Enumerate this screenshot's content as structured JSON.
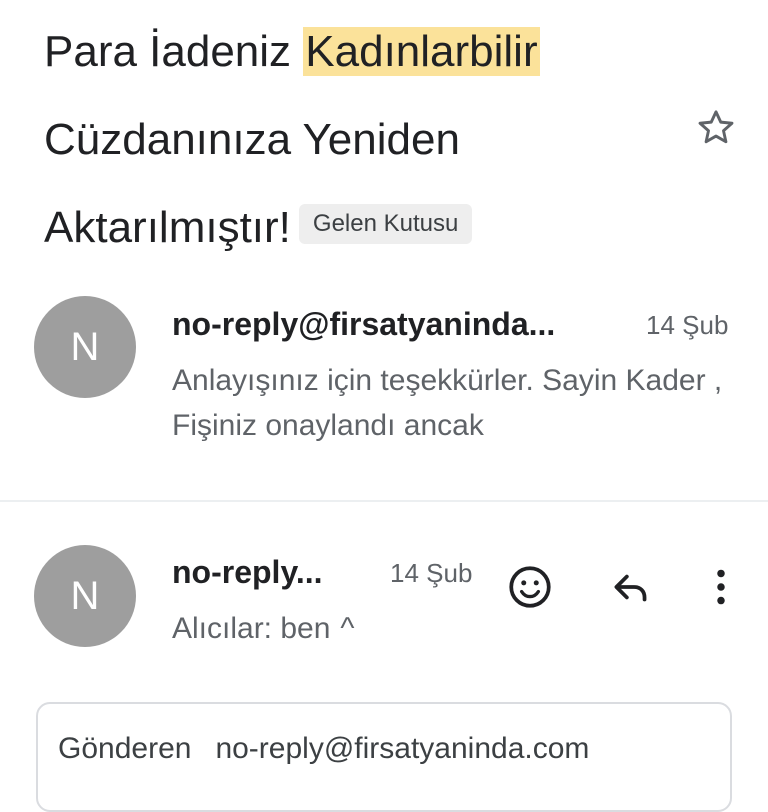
{
  "email": {
    "subject_prefix": "Para İadeniz ",
    "subject_highlight": "Kadınlarbilir",
    "subject_suffix": " Cüzdanınıza Yeniden Aktarılmıştır!",
    "label": "Gelen Kutusu",
    "star_icon": "star-outline-icon"
  },
  "messages": [
    {
      "avatar_letter": "N",
      "sender": "no-reply@firsatyaninda...",
      "date": "14 Şub",
      "snippet": "Anlayışınız için teşekkürler. Sayin Kader , Fişiniz onaylandı ancak"
    },
    {
      "avatar_letter": "N",
      "sender": "no-reply...",
      "date": "14 Şub",
      "recipients": "Alıcılar: ben",
      "recipients_chevron": "^",
      "actions": [
        "emoji-reaction-icon",
        "reply-icon",
        "more-vert-icon"
      ],
      "details": {
        "from_label": "Gönderen",
        "from_value": "no-reply@firsatyaninda.com"
      }
    }
  ],
  "colors": {
    "highlight": "#fbe29a",
    "avatar": "#9e9e9e",
    "chip_bg": "#eeeeee"
  }
}
